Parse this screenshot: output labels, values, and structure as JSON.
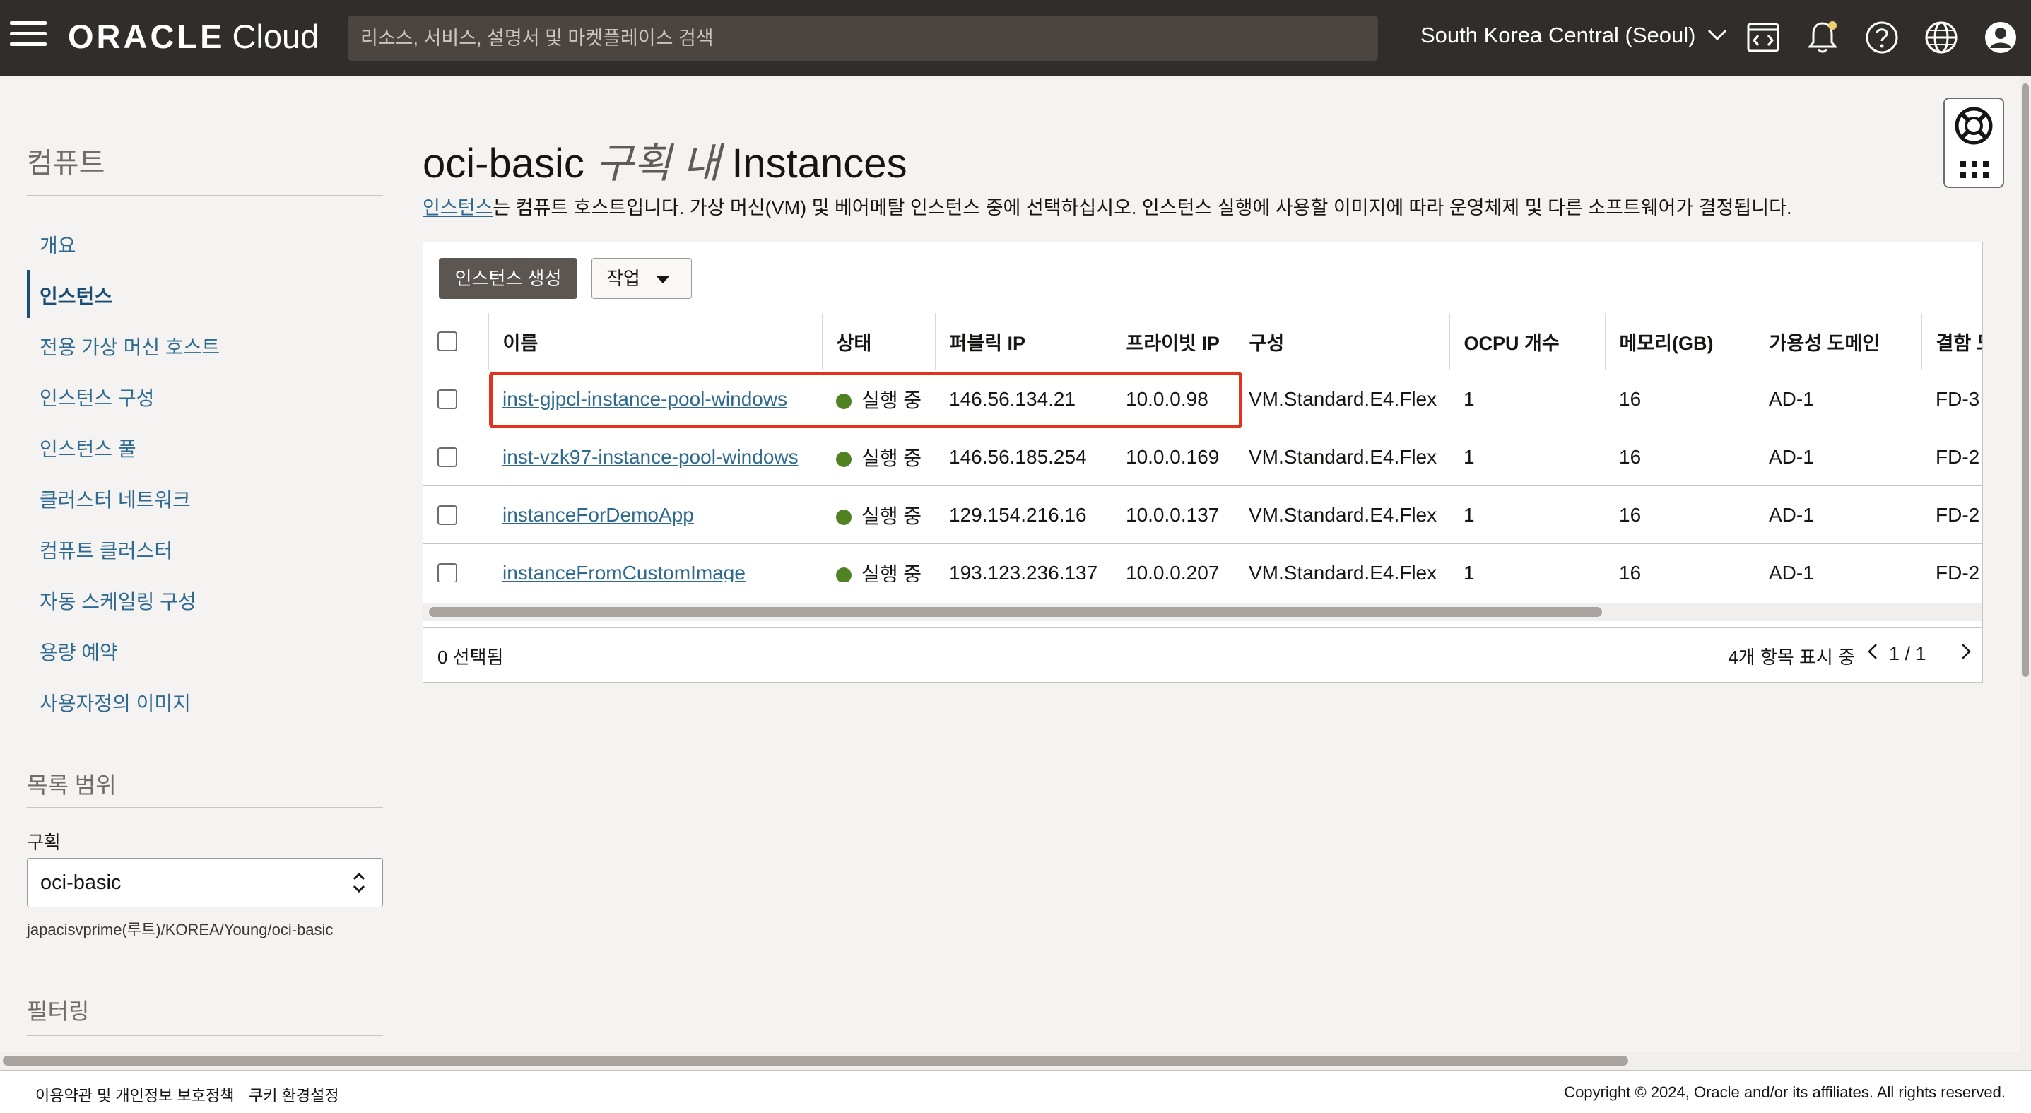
{
  "header": {
    "logo_brand": "ORACLE",
    "logo_product": "Cloud",
    "search_placeholder": "리소스, 서비스, 설명서 및 마켓플레이스 검색",
    "region": "South Korea Central (Seoul)"
  },
  "sidebar": {
    "title": "컴퓨트",
    "items": [
      {
        "label": "개요"
      },
      {
        "label": "인스턴스"
      },
      {
        "label": "전용 가상 머신 호스트"
      },
      {
        "label": "인스턴스 구성"
      },
      {
        "label": "인스턴스 풀"
      },
      {
        "label": "클러스터 네트워크"
      },
      {
        "label": "컴퓨트 클러스터"
      },
      {
        "label": "자동 스케일링 구성"
      },
      {
        "label": "용량 예약"
      },
      {
        "label": "사용자정의 이미지"
      }
    ],
    "list_scope_title": "목록 범위",
    "compartment_label": "구획",
    "compartment_value": "oci-basic",
    "compartment_path": "japacisvprime(루트)/KOREA/Young/oci-basic",
    "filter_title": "필터링"
  },
  "main": {
    "title_prefix": "oci-basic",
    "title_italic": "구획 내",
    "title_suffix": "Instances",
    "desc_link": "인스턴스",
    "desc_text": "는 컴퓨트 호스트입니다. 가상 머신(VM) 및 베어메탈 인스턴스 중에 선택하십시오. 인스턴스 실행에 사용할 이미지에 따라 운영체제 및 다른 소프트웨어가 결정됩니다.",
    "create_button": "인스턴스 생성",
    "actions_button": "작업",
    "columns": [
      "이름",
      "상태",
      "퍼블릭 IP",
      "프라이빗 IP",
      "구성",
      "OCPU 개수",
      "메모리(GB)",
      "가용성 도메인",
      "결함 도메인"
    ],
    "rows": [
      {
        "name": "inst-gjpcl-instance-pool-windows",
        "state": "실행 중",
        "public_ip": "146.56.134.21",
        "private_ip": "10.0.0.98",
        "shape": "VM.Standard.E4.Flex",
        "ocpu": "1",
        "memory": "16",
        "ad": "AD-1",
        "fd": "FD-3"
      },
      {
        "name": "inst-vzk97-instance-pool-windows",
        "state": "실행 중",
        "public_ip": "146.56.185.254",
        "private_ip": "10.0.0.169",
        "shape": "VM.Standard.E4.Flex",
        "ocpu": "1",
        "memory": "16",
        "ad": "AD-1",
        "fd": "FD-2"
      },
      {
        "name": "instanceForDemoApp",
        "state": "실행 중",
        "public_ip": "129.154.216.16",
        "private_ip": "10.0.0.137",
        "shape": "VM.Standard.E4.Flex",
        "ocpu": "1",
        "memory": "16",
        "ad": "AD-1",
        "fd": "FD-2"
      },
      {
        "name": "instanceFromCustomImage",
        "state": "실행 중",
        "public_ip": "193.123.236.137",
        "private_ip": "10.0.0.207",
        "shape": "VM.Standard.E4.Flex",
        "ocpu": "1",
        "memory": "16",
        "ad": "AD-1",
        "fd": "FD-2"
      }
    ],
    "selected_count": "0 선택됨",
    "showing_text": "4개 항목 표시 중",
    "page_indicator": "1 / 1"
  },
  "footer": {
    "terms": "이용약관 및 개인정보 보호정책",
    "cookies": "쿠키 환경설정",
    "copyright": "Copyright © 2024, Oracle and/or its affiliates. All rights reserved."
  },
  "colors": {
    "topbar": "#312d2a",
    "link": "#2e6a8f",
    "running_status": "#508223",
    "highlight_box": "#e0321c"
  }
}
